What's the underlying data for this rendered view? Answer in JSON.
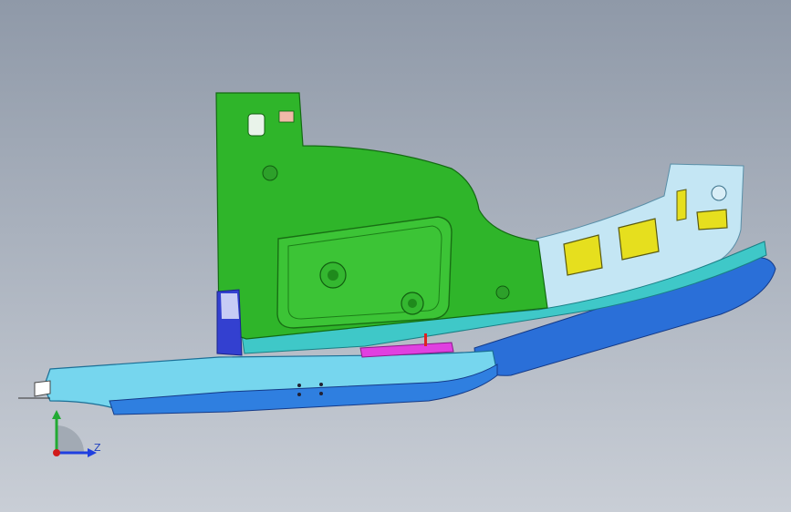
{
  "viewport": {
    "background_top": "#8f99a8",
    "background_bottom": "#c9ced6"
  },
  "model": {
    "part_colors": {
      "panel_green": "#2fb52a",
      "panel_green_dark": "#1f8a1c",
      "rear_panel": "#bfe3f2",
      "rocker_cyan": "#6fd3ea",
      "rocker_blue": "#2f7fe0",
      "rocker_dark_blue": "#1f4fb8",
      "window_yellow": "#e6df1e",
      "trim_magenta": "#e040e0",
      "accent_pink": "#f2b9a8",
      "edge_blue": "#3340d0"
    }
  },
  "triad": {
    "z_label": "Z",
    "x_color": "#1f3fe0",
    "y_color": "#22aa33",
    "origin_color": "#d11a1a"
  }
}
